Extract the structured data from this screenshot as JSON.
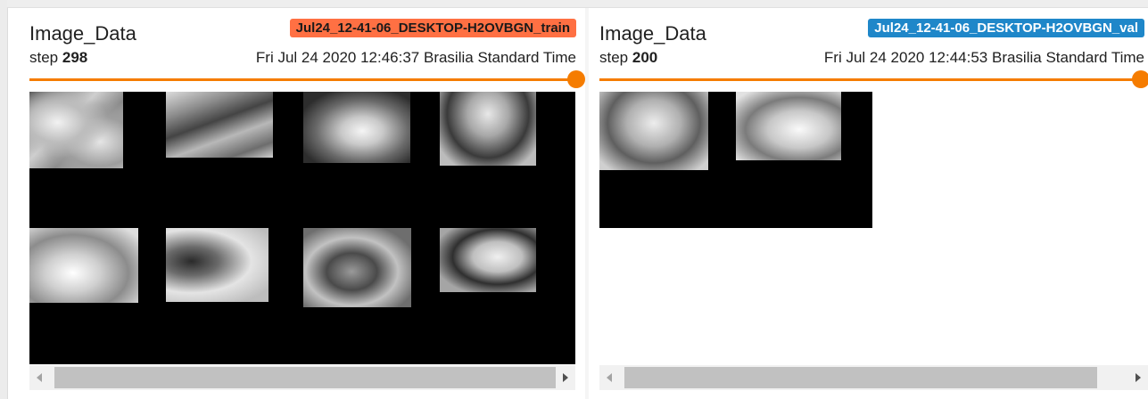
{
  "colors": {
    "train_badge": "#ff7043",
    "val_badge": "#1f87c9",
    "slider_accent": "#f57c00"
  },
  "cards": {
    "train": {
      "run_name": "Jul24_12-41-06_DESKTOP-H2OVBGN_train",
      "tag": "Image_Data",
      "step_label": "step",
      "step_value": "298",
      "wall_time": "Fri Jul 24 2020 12:46:37 Brasilia Standard Time",
      "slider_level": 1.0,
      "image_tiles": 8
    },
    "val": {
      "run_name": "Jul24_12-41-06_DESKTOP-H2OVBGN_val",
      "tag": "Image_Data",
      "step_label": "step",
      "step_value": "200",
      "wall_time": "Fri Jul 24 2020 12:44:53 Brasilia Standard Time",
      "slider_level": 1.0,
      "image_tiles": 2
    }
  },
  "icons": {
    "scroll_left": "scroll-left-arrow-icon",
    "scroll_right": "scroll-right-arrow-icon",
    "slider_thumb": "slider-thumb"
  }
}
